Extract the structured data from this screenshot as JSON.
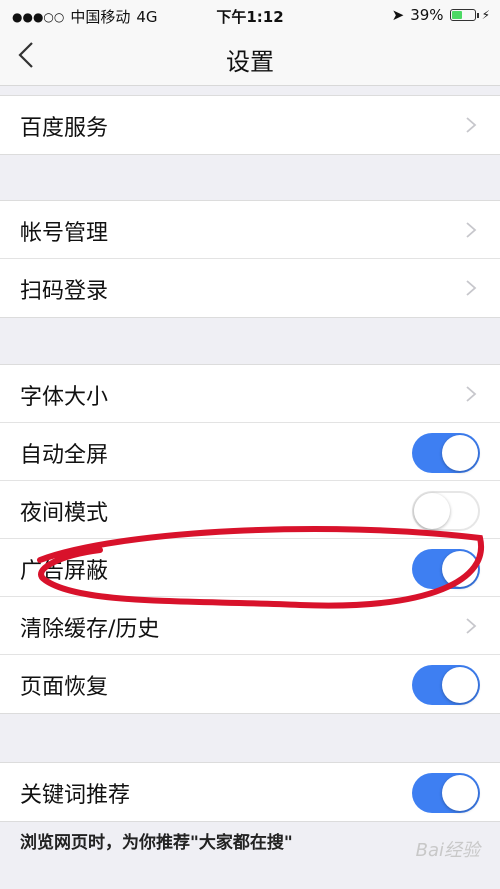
{
  "status": {
    "signal": "●●●○○",
    "carrier": "中国移动",
    "network": "4G",
    "time": "下午1:12",
    "battery": "39%"
  },
  "nav": {
    "title": "设置"
  },
  "groups": [
    {
      "rows": [
        {
          "label": "百度服务",
          "type": "chevron"
        }
      ]
    },
    {
      "rows": [
        {
          "label": "帐号管理",
          "type": "chevron"
        },
        {
          "label": "扫码登录",
          "type": "chevron"
        }
      ]
    },
    {
      "rows": [
        {
          "label": "字体大小",
          "type": "chevron"
        },
        {
          "label": "自动全屏",
          "type": "toggle",
          "on": true
        },
        {
          "label": "夜间模式",
          "type": "toggle",
          "on": false
        },
        {
          "label": "广告屏蔽",
          "type": "toggle",
          "on": true
        },
        {
          "label": "清除缓存/历史",
          "type": "chevron"
        },
        {
          "label": "页面恢复",
          "type": "toggle",
          "on": true
        }
      ]
    },
    {
      "rows": [
        {
          "label": "关键词推荐",
          "type": "toggle",
          "on": true
        }
      ]
    }
  ],
  "footer_note": "浏览网页时，为你推荐\"大家都在搜\"",
  "watermark": "Bai经验",
  "colors": {
    "toggle_on": "#3e7ff2",
    "annotation": "#d8122b"
  }
}
